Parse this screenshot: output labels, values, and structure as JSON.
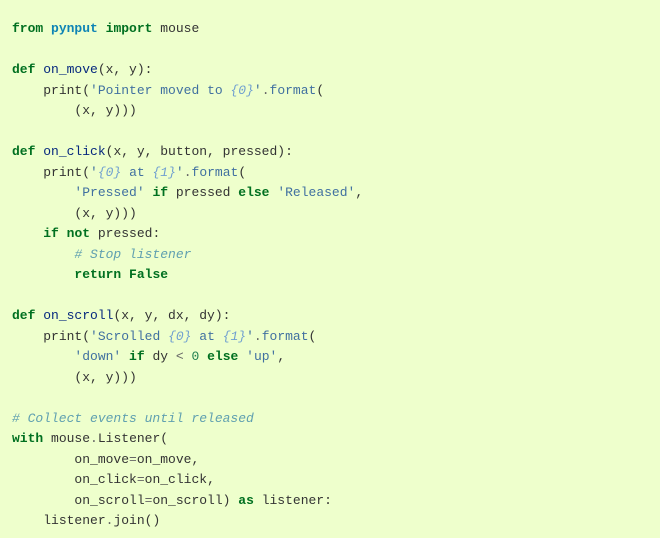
{
  "code": {
    "l1": {
      "kw_from": "from",
      "mod": "pynput",
      "kw_import": "import",
      "name": "mouse"
    },
    "l3": {
      "kw_def": "def",
      "fn": "on_move",
      "params": "(x, y):"
    },
    "l4": {
      "indent": "    ",
      "call": "print",
      "open": "(",
      "s1": "'Pointer moved to ",
      "ph": "{0}",
      "s2": "'",
      "dot": ".",
      "fmt": "format",
      "open2": "("
    },
    "l5": {
      "indent": "        ",
      "tuple": "(x, y)))"
    },
    "l7": {
      "kw_def": "def",
      "fn": "on_click",
      "params": "(x, y, button, pressed):"
    },
    "l8": {
      "indent": "    ",
      "call": "print",
      "open": "(",
      "s1": "'",
      "ph1": "{0}",
      "mid": " at ",
      "ph2": "{1}",
      "s2": "'",
      "dot": ".",
      "fmt": "format",
      "open2": "("
    },
    "l9": {
      "indent": "        ",
      "s1": "'Pressed'",
      "sp": " ",
      "kw_if": "if",
      "cond": " pressed ",
      "kw_else": "else",
      "sp2": " ",
      "s2": "'Released'",
      "comma": ","
    },
    "l10": {
      "indent": "        ",
      "tuple": "(x, y)))"
    },
    "l11": {
      "indent": "    ",
      "kw_if": "if",
      "sp": " ",
      "kw_not": "not",
      "cond": " pressed:"
    },
    "l12": {
      "indent": "        ",
      "comment": "# Stop listener"
    },
    "l13": {
      "indent": "        ",
      "kw_return": "return",
      "sp": " ",
      "kw_false": "False"
    },
    "l15": {
      "kw_def": "def",
      "fn": "on_scroll",
      "params": "(x, y, dx, dy):"
    },
    "l16": {
      "indent": "    ",
      "call": "print",
      "open": "(",
      "s1": "'Scrolled ",
      "ph1": "{0}",
      "mid": " at ",
      "ph2": "{1}",
      "s2": "'",
      "dot": ".",
      "fmt": "format",
      "open2": "("
    },
    "l17": {
      "indent": "        ",
      "s1": "'down'",
      "sp": " ",
      "kw_if": "if",
      "cond_a": " dy ",
      "op": "<",
      "sp2": " ",
      "num": "0",
      "sp3": " ",
      "kw_else": "else",
      "sp4": " ",
      "s2": "'up'",
      "comma": ","
    },
    "l18": {
      "indent": "        ",
      "tuple": "(x, y)))"
    },
    "l20": {
      "comment": "# Collect events until released"
    },
    "l21": {
      "kw_with": "with",
      "sp": " ",
      "obj": "mouse",
      "dot": ".",
      "cls": "Listener",
      "open": "("
    },
    "l22": {
      "indent": "        ",
      "arg": "on_move",
      "eq": "=",
      "val": "on_move,",
      "comma": ""
    },
    "l23": {
      "indent": "        ",
      "arg": "on_click",
      "eq": "=",
      "val": "on_click,",
      "comma": ""
    },
    "l24": {
      "indent": "        ",
      "arg": "on_scroll",
      "eq": "=",
      "val": "on_scroll) ",
      "kw_as": "as",
      "tail": " listener:"
    },
    "l25": {
      "indent": "    ",
      "stmt_a": "listener",
      "dot": ".",
      "stmt_b": "join()"
    }
  }
}
